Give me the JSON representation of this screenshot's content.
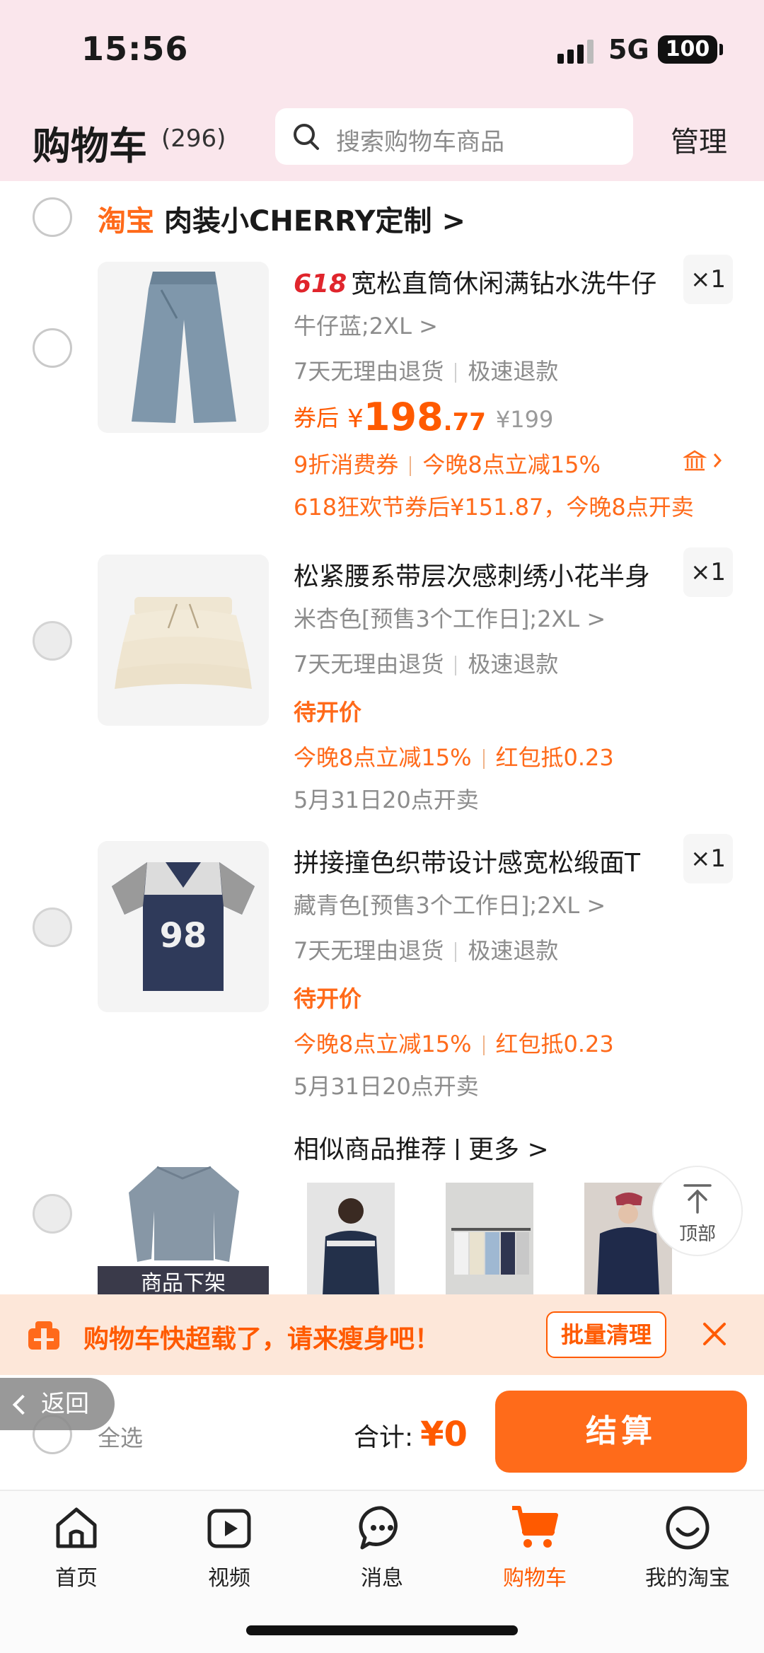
{
  "status": {
    "time": "15:56",
    "network": "5G",
    "battery": "100"
  },
  "header": {
    "title": "购物车",
    "count": "(296)",
    "search_placeholder": "搜索购物车商品",
    "manage": "管理"
  },
  "shop": {
    "platform": "淘宝",
    "name": "肉装小CHERRY定制",
    "chevron": ">"
  },
  "items": [
    {
      "tag": "618",
      "title": "宽松直筒休闲满钻水洗牛仔",
      "qty": "×1",
      "spec": "牛仔蓝;2XL >",
      "service_a": "7天无理由退货",
      "service_b": "极速退款",
      "price_prefix": "券后",
      "price_yen": "¥",
      "price_int": "198",
      "price_dec": ".77",
      "price_orig": "¥199",
      "promo_a": "9折消费券",
      "promo_b": "今晚8点立减15%",
      "promo_line2": "618狂欢节券后¥151.87，今晚8点开卖"
    },
    {
      "title": "松紧腰系带层次感刺绣小花半身",
      "qty": "×1",
      "spec": "米杏色[预售3个工作日];2XL >",
      "service_a": "7天无理由退货",
      "service_b": "极速退款",
      "price_label": "待开价",
      "promo_a": "今晚8点立减15%",
      "promo_b": "红包抵0.23",
      "sale_time": "5月31日20点开卖"
    },
    {
      "title": "拼接撞色织带设计感宽松缎面T",
      "qty": "×1",
      "spec": "藏青色[预售3个工作日];2XL >",
      "service_a": "7天无理由退货",
      "service_b": "极速退款",
      "price_label": "待开价",
      "promo_a": "今晚8点立减15%",
      "promo_b": "红包抵0.23",
      "sale_time": "5月31日20点开卖",
      "jersey_number": "98"
    }
  ],
  "unavailable": {
    "label": "商品下架",
    "similar": "相似商品推荐",
    "more": "更多 >"
  },
  "to_top": "顶部",
  "banner": {
    "message": "购物车快超载了，请来瘦身吧！",
    "clear_button": "批量清理"
  },
  "back": "返回",
  "footer": {
    "select_all": "全选",
    "total_label": "合计:",
    "total_amount": "¥0",
    "checkout": "结算"
  },
  "tabs": [
    {
      "label": "首页",
      "icon": "home-icon"
    },
    {
      "label": "视频",
      "icon": "video-icon"
    },
    {
      "label": "消息",
      "icon": "message-icon"
    },
    {
      "label": "购物车",
      "icon": "cart-icon",
      "active": true
    },
    {
      "label": "我的淘宝",
      "icon": "profile-icon"
    }
  ],
  "colors": {
    "accent": "#ff5a00",
    "header_bg": "#fae6ec",
    "banner_bg": "#fde7d9",
    "red_tag": "#e0252c"
  }
}
